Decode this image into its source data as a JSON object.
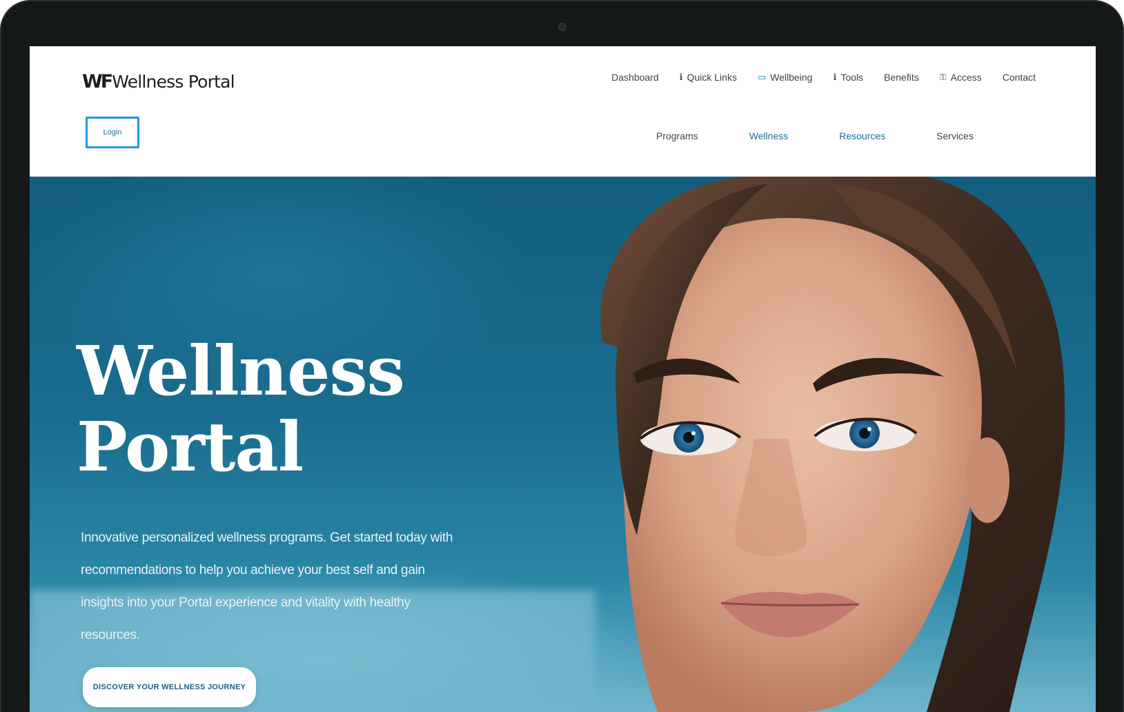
{
  "site": {
    "logo_mark": "WF",
    "logo_text": "Wellness Portal"
  },
  "top_nav": [
    {
      "label": "Dashboard",
      "icon": ""
    },
    {
      "label": "Quick Links",
      "icon": "info-icon"
    },
    {
      "label": "Wellbeing",
      "icon": "card-icon"
    },
    {
      "label": "Tools",
      "icon": "info-icon"
    },
    {
      "label": "Benefits",
      "icon": ""
    },
    {
      "label": "Access",
      "icon": "key-icon"
    },
    {
      "label": "Contact",
      "icon": ""
    }
  ],
  "login_label": "Login",
  "sub_nav": [
    {
      "label": "Programs"
    },
    {
      "label": "Wellness"
    },
    {
      "label": "Resources"
    },
    {
      "label": "Services"
    }
  ],
  "hero": {
    "title_line1": "Wellness",
    "title_line2": "Portal",
    "description": "Innovative personalized wellness programs. Get started today with recommendations to help you achieve your best self and gain insights into your Portal experience and vitality with healthy resources.",
    "cta_label": "Discover your wellness journey"
  },
  "colors": {
    "accent": "#1d9ad6",
    "hero_bg": "#1a6d8f",
    "device_frame": "#141819"
  }
}
